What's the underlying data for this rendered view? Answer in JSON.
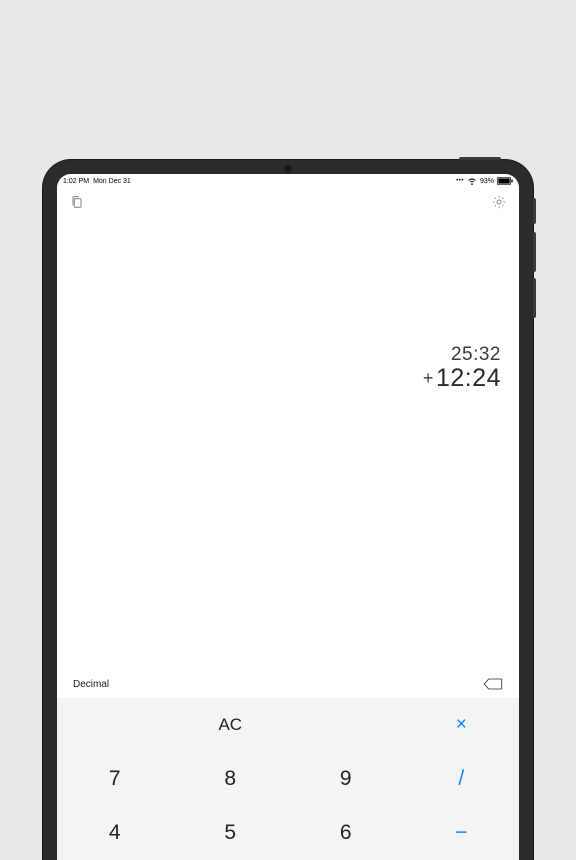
{
  "status": {
    "time": "1:02 PM",
    "date": "Mon Dec 31",
    "battery_pct": "93%"
  },
  "display": {
    "line1": "25:32",
    "line2_op": "+",
    "line2_val": "12:24"
  },
  "mode": {
    "label": "Decimal"
  },
  "keys": {
    "ac": "AC",
    "times": "×",
    "k7": "7",
    "k8": "8",
    "k9": "9",
    "div": "/",
    "k4": "4",
    "k5": "5",
    "k6": "6",
    "minus": "−"
  }
}
